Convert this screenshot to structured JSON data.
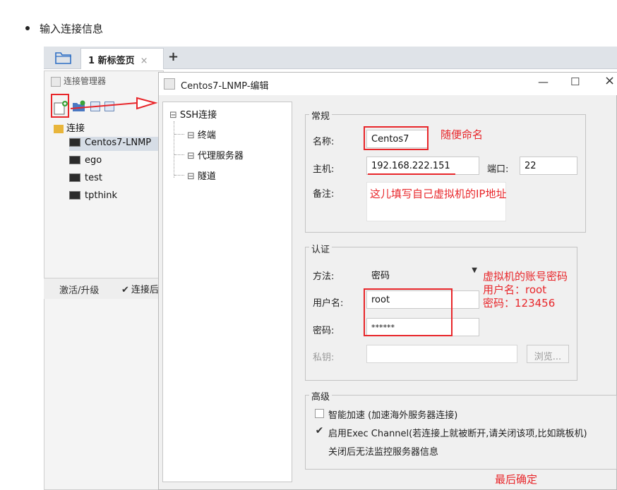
{
  "heading": "输入连接信息",
  "tab": {
    "label": "1 新标签页",
    "close": "×",
    "add": "+"
  },
  "left_panel": {
    "title": "连接管理器",
    "root": "连接",
    "items": [
      "Centos7-LNMP",
      "ego",
      "test",
      "tpthink"
    ],
    "activate": "激活/升级",
    "connect_label": "连接后"
  },
  "dialog": {
    "title": "Centos7-LNMP-编辑",
    "controls": {
      "minimize": "—",
      "maximize": "☐",
      "close": "×"
    },
    "nav": {
      "root": "SSH连接",
      "children": [
        "终端",
        "代理服务器",
        "隧道"
      ]
    },
    "general": {
      "label": "常规",
      "name_label": "名称:",
      "name_value": "Centos7",
      "host_label": "主机:",
      "host_value": "192.168.222.151",
      "port_label": "端口:",
      "port_value": "22",
      "remark_label": "备注:"
    },
    "auth": {
      "label": "认证",
      "method_label": "方法:",
      "method_value": "密码",
      "user_label": "用户名:",
      "user_value": "root",
      "password_label": "密码:",
      "password_value": "******",
      "key_label": "私钥:",
      "browse": "浏览..."
    },
    "advanced": {
      "label": "高级",
      "accel_label": "智能加速 (加速海外服务器连接)",
      "exec_label": "启用Exec Channel(若连接上就被断开,请关闭该项,比如跳板机)",
      "exec_note": "关闭后无法监控服务器信息",
      "accel_checked": false,
      "exec_checked": true
    }
  },
  "annotations": {
    "name_hint": "随便命名",
    "ip_hint": "这儿填写自己虚拟机的IP地址",
    "account_hint_1": "虚拟机的账号密码",
    "account_hint_2": "用户名：root",
    "account_hint_3": "密码：123456",
    "confirm_hint": "最后确定",
    "color": "#e8262a"
  }
}
